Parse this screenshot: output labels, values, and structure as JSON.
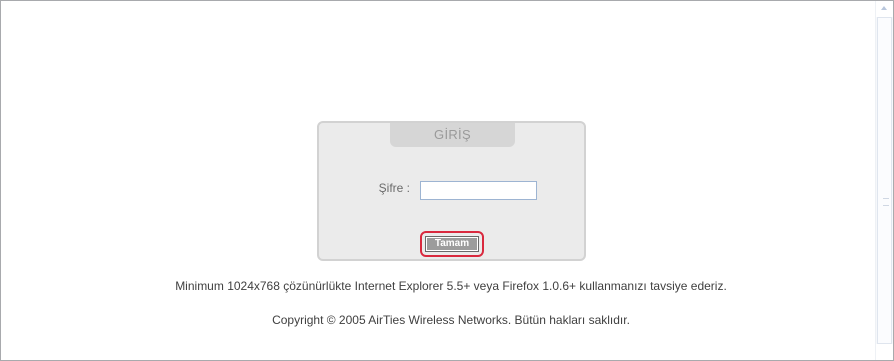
{
  "login": {
    "title": "GİRİŞ",
    "password_label": "Şifre :",
    "password_value": "",
    "submit_label": "Tamam"
  },
  "footer": {
    "recommendation": "Minimum 1024x768 çözünürlükte Internet Explorer 5.5+ veya Firefox 1.0.6+ kullanmanızı tavsiye ederiz.",
    "copyright": "Copyright © 2005 AirTies Wireless Networks. Bütün hakları saklıdır."
  },
  "colors": {
    "box_background": "#ebebeb",
    "tab_background": "#d6d6d6",
    "highlight": "#d9293e",
    "button_background": "#9c9c9c"
  },
  "icons": {
    "scroll_up": "scroll-up-arrow-icon"
  }
}
